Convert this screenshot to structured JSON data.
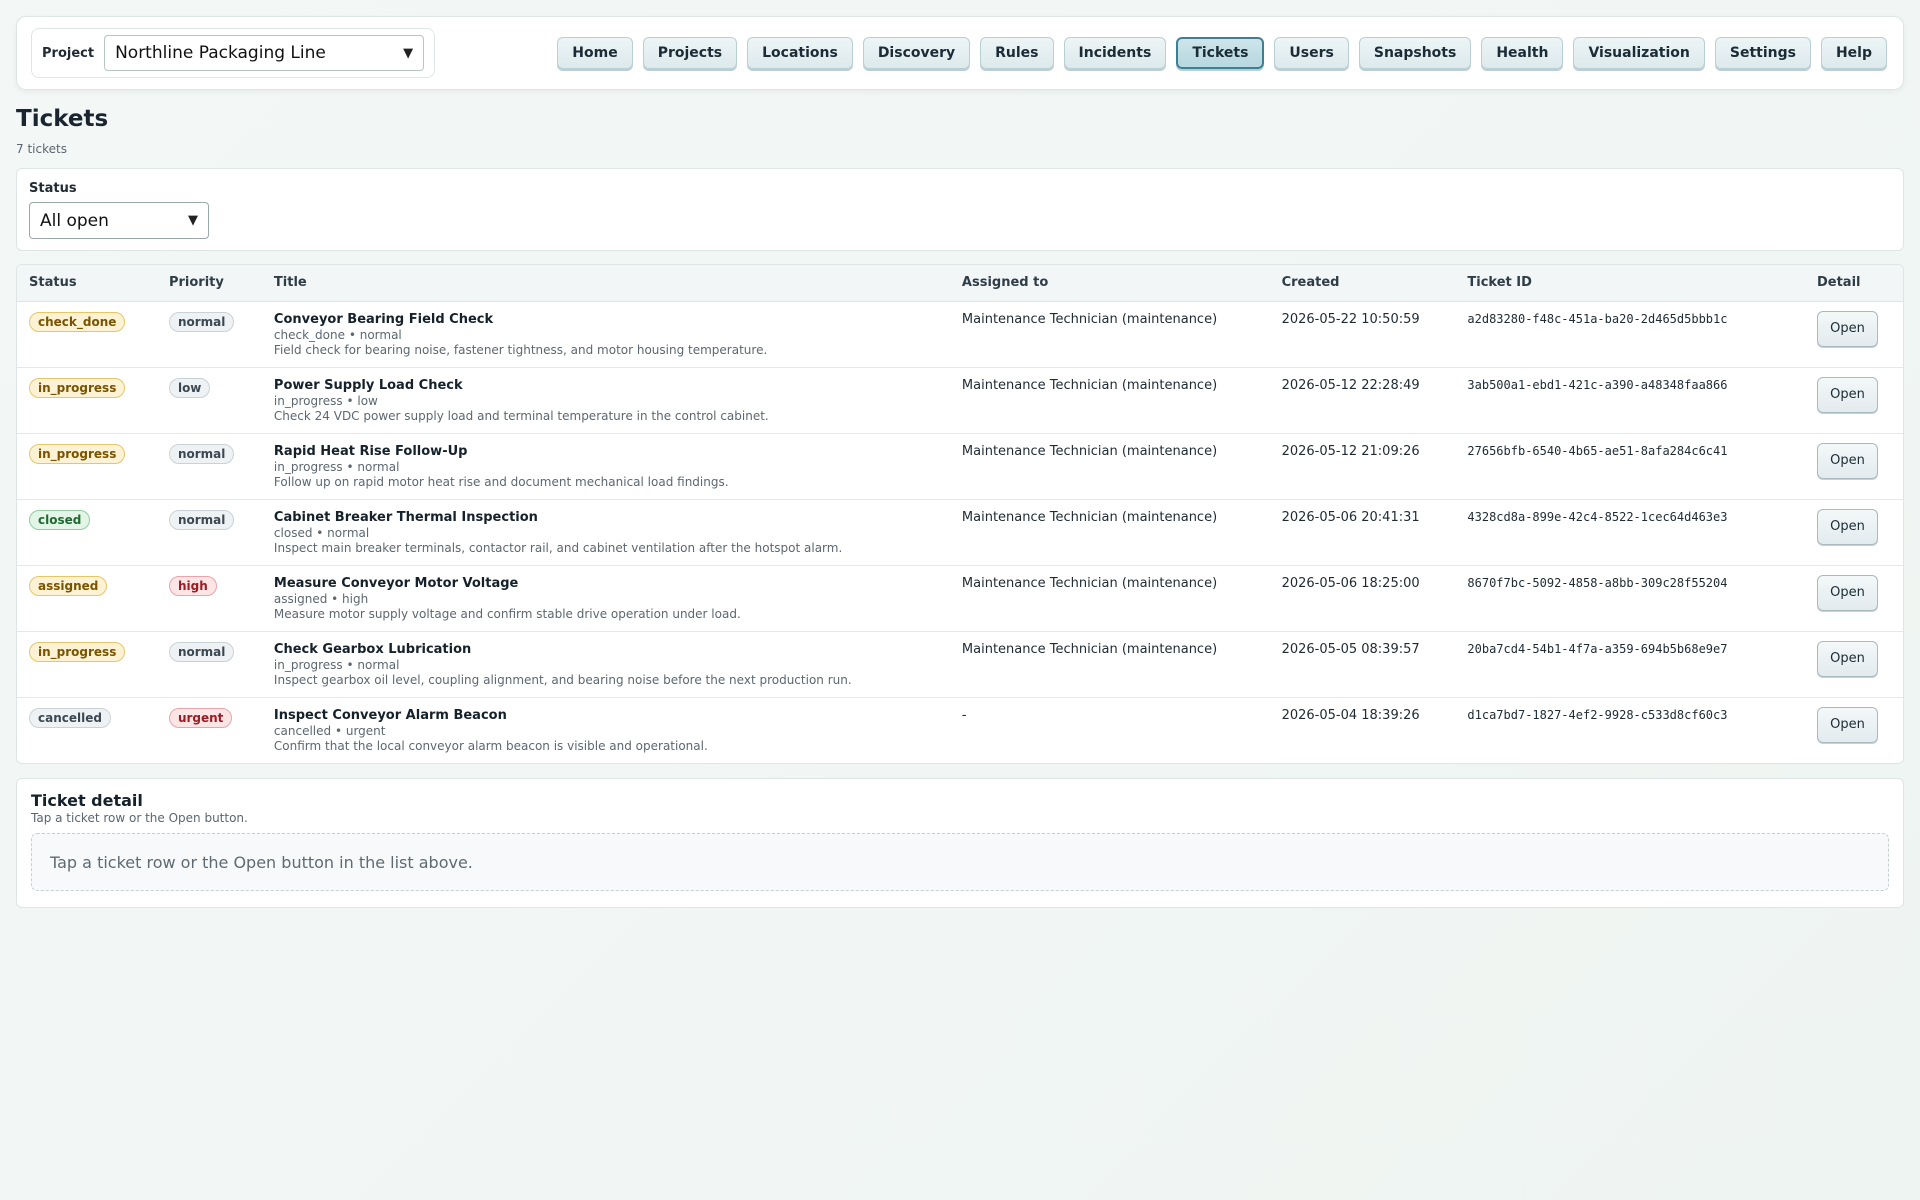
{
  "header": {
    "project_label": "Project",
    "project_value": "Northline Packaging Line",
    "nav": [
      {
        "label": "Home",
        "active": false
      },
      {
        "label": "Projects",
        "active": false
      },
      {
        "label": "Locations",
        "active": false
      },
      {
        "label": "Discovery",
        "active": false
      },
      {
        "label": "Rules",
        "active": false
      },
      {
        "label": "Incidents",
        "active": false
      },
      {
        "label": "Tickets",
        "active": true
      },
      {
        "label": "Users",
        "active": false
      },
      {
        "label": "Snapshots",
        "active": false
      },
      {
        "label": "Health",
        "active": false
      },
      {
        "label": "Visualization",
        "active": false
      },
      {
        "label": "Settings",
        "active": false
      },
      {
        "label": "Help",
        "active": false
      }
    ]
  },
  "page": {
    "title": "Tickets",
    "count": "7 tickets"
  },
  "filter": {
    "label": "Status",
    "value": "All open"
  },
  "table": {
    "headers": [
      "Status",
      "Priority",
      "Title",
      "Assigned to",
      "Created",
      "Ticket ID",
      "Detail"
    ],
    "open_label": "Open",
    "rows": [
      {
        "status": "check_done",
        "status_color": "yellow",
        "priority": "normal",
        "priority_color": "gray",
        "title": "Conveyor Bearing Field Check",
        "meta": "check_done • normal",
        "desc": "Field check for bearing noise, fastener tightness, and motor housing temperature.",
        "assigned": "Maintenance Technician (maintenance)",
        "created": "2026-05-22 10:50:59",
        "id": "a2d83280-f48c-451a-ba20-2d465d5bbb1c"
      },
      {
        "status": "in_progress",
        "status_color": "yellow",
        "priority": "low",
        "priority_color": "gray",
        "title": "Power Supply Load Check",
        "meta": "in_progress • low",
        "desc": "Check 24 VDC power supply load and terminal temperature in the control cabinet.",
        "assigned": "Maintenance Technician (maintenance)",
        "created": "2026-05-12 22:28:49",
        "id": "3ab500a1-ebd1-421c-a390-a48348faa866"
      },
      {
        "status": "in_progress",
        "status_color": "yellow",
        "priority": "normal",
        "priority_color": "gray",
        "title": "Rapid Heat Rise Follow-Up",
        "meta": "in_progress • normal",
        "desc": "Follow up on rapid motor heat rise and document mechanical load findings.",
        "assigned": "Maintenance Technician (maintenance)",
        "created": "2026-05-12 21:09:26",
        "id": "27656bfb-6540-4b65-ae51-8afa284c6c41"
      },
      {
        "status": "closed",
        "status_color": "green",
        "priority": "normal",
        "priority_color": "gray",
        "title": "Cabinet Breaker Thermal Inspection",
        "meta": "closed • normal",
        "desc": "Inspect main breaker terminals, contactor rail, and cabinet ventilation after the hotspot alarm.",
        "assigned": "Maintenance Technician (maintenance)",
        "created": "2026-05-06 20:41:31",
        "id": "4328cd8a-899e-42c4-8522-1cec64d463e3"
      },
      {
        "status": "assigned",
        "status_color": "yellow",
        "priority": "high",
        "priority_color": "red",
        "title": "Measure Conveyor Motor Voltage",
        "meta": "assigned • high",
        "desc": "Measure motor supply voltage and confirm stable drive operation under load.",
        "assigned": "Maintenance Technician (maintenance)",
        "created": "2026-05-06 18:25:00",
        "id": "8670f7bc-5092-4858-a8bb-309c28f55204"
      },
      {
        "status": "in_progress",
        "status_color": "yellow",
        "priority": "normal",
        "priority_color": "gray",
        "title": "Check Gearbox Lubrication",
        "meta": "in_progress • normal",
        "desc": "Inspect gearbox oil level, coupling alignment, and bearing noise before the next production run.",
        "assigned": "Maintenance Technician (maintenance)",
        "created": "2026-05-05 08:39:57",
        "id": "20ba7cd4-54b1-4f7a-a359-694b5b68e9e7"
      },
      {
        "status": "cancelled",
        "status_color": "gray",
        "priority": "urgent",
        "priority_color": "red",
        "title": "Inspect Conveyor Alarm Beacon",
        "meta": "cancelled • urgent",
        "desc": "Confirm that the local conveyor alarm beacon is visible and operational.",
        "assigned": "-",
        "created": "2026-05-04 18:39:26",
        "id": "d1ca7bd7-1827-4ef2-9928-c533d8cf60c3"
      }
    ]
  },
  "detail": {
    "title": "Ticket detail",
    "subtitle": "Tap a ticket row or the Open button.",
    "empty": "Tap a ticket row or the Open button in the list above."
  }
}
